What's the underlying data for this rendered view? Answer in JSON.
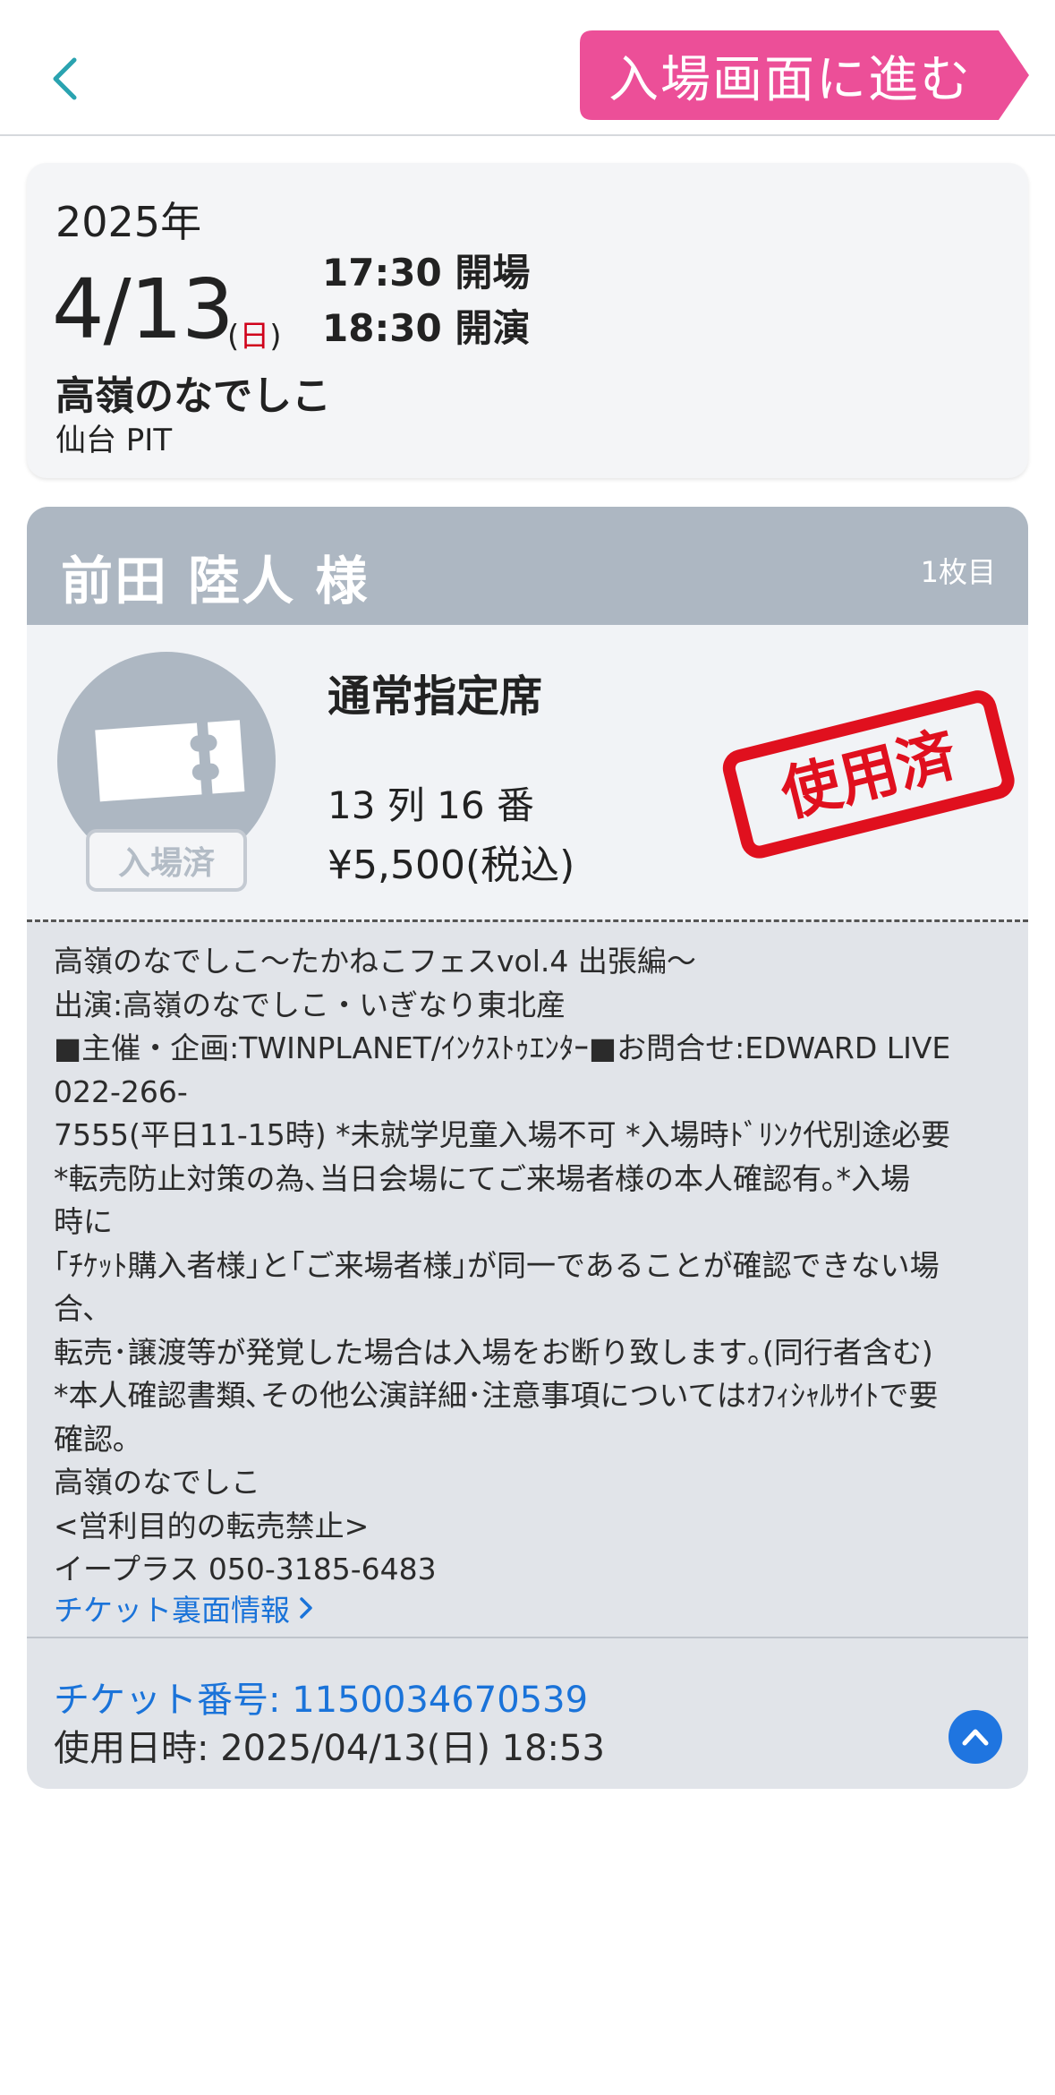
{
  "header": {
    "enter_label": "入場画面に進む",
    "accent_color": "#ec4f98"
  },
  "event": {
    "year": "2025年",
    "date": "4/13",
    "dow_open": "(",
    "dow": "日",
    "dow_close": ")",
    "open_time": "17:30 開場",
    "start_time": "18:30 開演",
    "artist": "高嶺のなでしこ",
    "venue": "仙台 PIT"
  },
  "ticket": {
    "holder": "前田 陸人 様",
    "count": "1枚目",
    "entered_badge": "入場済",
    "seat_type": "通常指定席",
    "seat": "13 列 16 番",
    "price": "¥5,500(税込)",
    "stamp": "使用済",
    "notes": [
      "高嶺のなでしこ〜たかねこフェスvol.4 出張編〜",
      "出演:高嶺のなでしこ・いぎなり東北産",
      "■主催・企画:TWINPLANET/ｲﾝｸｽﾄｩｴﾝﾀｰ■お問合せ:EDWARD LIVE",
      "022-266-",
      "7555(平日11-15時) *未就学児童入場不可 *入場時ﾄﾞﾘﾝｸ代別途必要",
      "*転売防止対策の為､当日会場にてご来場者様の本人確認有｡*入場",
      "時に",
      "｢ﾁｹｯﾄ購入者様｣と｢ご来場者様｣が同一であることが確認できない場",
      "合､",
      "転売･譲渡等が発覚した場合は入場をお断り致します｡(同行者含む)",
      "*本人確認書類､その他公演詳細･注意事項についてはｵﾌｨｼｬﾙｻｲﾄで要",
      "確認｡",
      "高嶺のなでしこ",
      "<営利目的の転売禁止>",
      "イープラス 050-3185-6483"
    ],
    "back_info_link": "チケット裏面情報",
    "ticket_number": "チケット番号: 1150034670539",
    "used_at": "使用日時: 2025/04/13(日) 18:53"
  }
}
